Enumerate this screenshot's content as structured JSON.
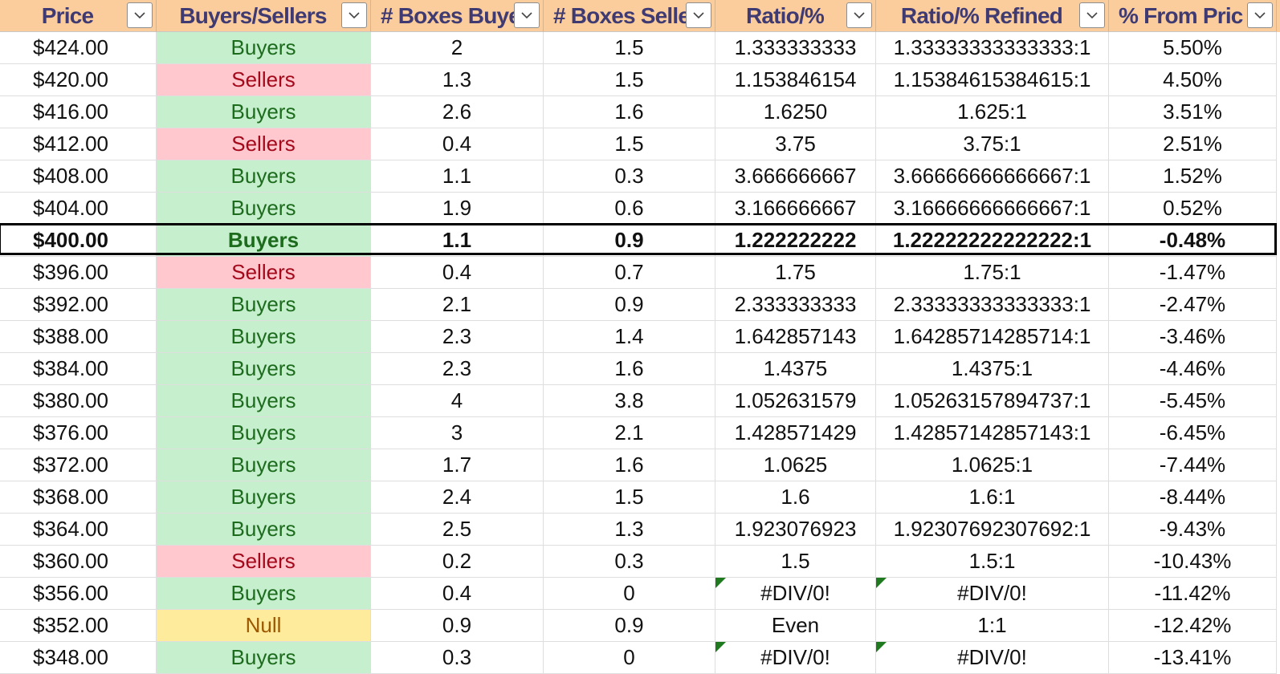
{
  "headers": [
    {
      "label": "Price",
      "filter_icon": "chevron-down-icon"
    },
    {
      "label": "Buyers/Sellers",
      "filter_icon": "chevron-down-icon"
    },
    {
      "label": "# Boxes Buye",
      "filter_icon": "chevron-down-icon"
    },
    {
      "label": "# Boxes Selle",
      "filter_icon": "chevron-down-icon"
    },
    {
      "label": "Ratio/%",
      "filter_icon": "chevron-down-icon"
    },
    {
      "label": "Ratio/% Refined",
      "filter_icon": "chevron-down-icon"
    },
    {
      "label": "% From Pric",
      "filter_icon": "chevron-down-icon"
    }
  ],
  "status_colors": {
    "Buyers": {
      "bg": "#c6efce",
      "fg": "#1d6b1d"
    },
    "Sellers": {
      "bg": "#ffc7ce",
      "fg": "#a4091b"
    },
    "Null": {
      "bg": "#ffeb9c",
      "fg": "#9c5700"
    }
  },
  "header_color": "#fbcd9c",
  "header_text_color": "#3f3b72",
  "error_indicator_color": "#1f7a1f",
  "selected_row_index": 6,
  "rows": [
    {
      "price": "$424.00",
      "status": "Buyers",
      "boxes_bought": "2",
      "boxes_sold": "1.5",
      "ratio": "1.333333333",
      "ratio_refined": "1.33333333333333:1",
      "pct_from_price": "5.50%"
    },
    {
      "price": "$420.00",
      "status": "Sellers",
      "boxes_bought": "1.3",
      "boxes_sold": "1.5",
      "ratio": "1.153846154",
      "ratio_refined": "1.15384615384615:1",
      "pct_from_price": "4.50%"
    },
    {
      "price": "$416.00",
      "status": "Buyers",
      "boxes_bought": "2.6",
      "boxes_sold": "1.6",
      "ratio": "1.6250",
      "ratio_refined": "1.625:1",
      "pct_from_price": "3.51%"
    },
    {
      "price": "$412.00",
      "status": "Sellers",
      "boxes_bought": "0.4",
      "boxes_sold": "1.5",
      "ratio": "3.75",
      "ratio_refined": "3.75:1",
      "pct_from_price": "2.51%"
    },
    {
      "price": "$408.00",
      "status": "Buyers",
      "boxes_bought": "1.1",
      "boxes_sold": "0.3",
      "ratio": "3.666666667",
      "ratio_refined": "3.66666666666667:1",
      "pct_from_price": "1.52%"
    },
    {
      "price": "$404.00",
      "status": "Buyers",
      "boxes_bought": "1.9",
      "boxes_sold": "0.6",
      "ratio": "3.166666667",
      "ratio_refined": "3.16666666666667:1",
      "pct_from_price": "0.52%"
    },
    {
      "price": "$400.00",
      "status": "Buyers",
      "boxes_bought": "1.1",
      "boxes_sold": "0.9",
      "ratio": "1.222222222",
      "ratio_refined": "1.22222222222222:1",
      "pct_from_price": "-0.48%"
    },
    {
      "price": "$396.00",
      "status": "Sellers",
      "boxes_bought": "0.4",
      "boxes_sold": "0.7",
      "ratio": "1.75",
      "ratio_refined": "1.75:1",
      "pct_from_price": "-1.47%"
    },
    {
      "price": "$392.00",
      "status": "Buyers",
      "boxes_bought": "2.1",
      "boxes_sold": "0.9",
      "ratio": "2.333333333",
      "ratio_refined": "2.33333333333333:1",
      "pct_from_price": "-2.47%"
    },
    {
      "price": "$388.00",
      "status": "Buyers",
      "boxes_bought": "2.3",
      "boxes_sold": "1.4",
      "ratio": "1.642857143",
      "ratio_refined": "1.64285714285714:1",
      "pct_from_price": "-3.46%"
    },
    {
      "price": "$384.00",
      "status": "Buyers",
      "boxes_bought": "2.3",
      "boxes_sold": "1.6",
      "ratio": "1.4375",
      "ratio_refined": "1.4375:1",
      "pct_from_price": "-4.46%"
    },
    {
      "price": "$380.00",
      "status": "Buyers",
      "boxes_bought": "4",
      "boxes_sold": "3.8",
      "ratio": "1.052631579",
      "ratio_refined": "1.05263157894737:1",
      "pct_from_price": "-5.45%"
    },
    {
      "price": "$376.00",
      "status": "Buyers",
      "boxes_bought": "3",
      "boxes_sold": "2.1",
      "ratio": "1.428571429",
      "ratio_refined": "1.42857142857143:1",
      "pct_from_price": "-6.45%"
    },
    {
      "price": "$372.00",
      "status": "Buyers",
      "boxes_bought": "1.7",
      "boxes_sold": "1.6",
      "ratio": "1.0625",
      "ratio_refined": "1.0625:1",
      "pct_from_price": "-7.44%"
    },
    {
      "price": "$368.00",
      "status": "Buyers",
      "boxes_bought": "2.4",
      "boxes_sold": "1.5",
      "ratio": "1.6",
      "ratio_refined": "1.6:1",
      "pct_from_price": "-8.44%"
    },
    {
      "price": "$364.00",
      "status": "Buyers",
      "boxes_bought": "2.5",
      "boxes_sold": "1.3",
      "ratio": "1.923076923",
      "ratio_refined": "1.92307692307692:1",
      "pct_from_price": "-9.43%"
    },
    {
      "price": "$360.00",
      "status": "Sellers",
      "boxes_bought": "0.2",
      "boxes_sold": "0.3",
      "ratio": "1.5",
      "ratio_refined": "1.5:1",
      "pct_from_price": "-10.43%"
    },
    {
      "price": "$356.00",
      "status": "Buyers",
      "boxes_bought": "0.4",
      "boxes_sold": "0",
      "ratio": "#DIV/0!",
      "ratio_refined": "#DIV/0!",
      "pct_from_price": "-11.42%",
      "error": true
    },
    {
      "price": "$352.00",
      "status": "Null",
      "boxes_bought": "0.9",
      "boxes_sold": "0.9",
      "ratio": "Even",
      "ratio_refined": "1:1",
      "pct_from_price": "-12.42%"
    },
    {
      "price": "$348.00",
      "status": "Buyers",
      "boxes_bought": "0.3",
      "boxes_sold": "0",
      "ratio": "#DIV/0!",
      "ratio_refined": "#DIV/0!",
      "pct_from_price": "-13.41%",
      "error": true
    }
  ]
}
